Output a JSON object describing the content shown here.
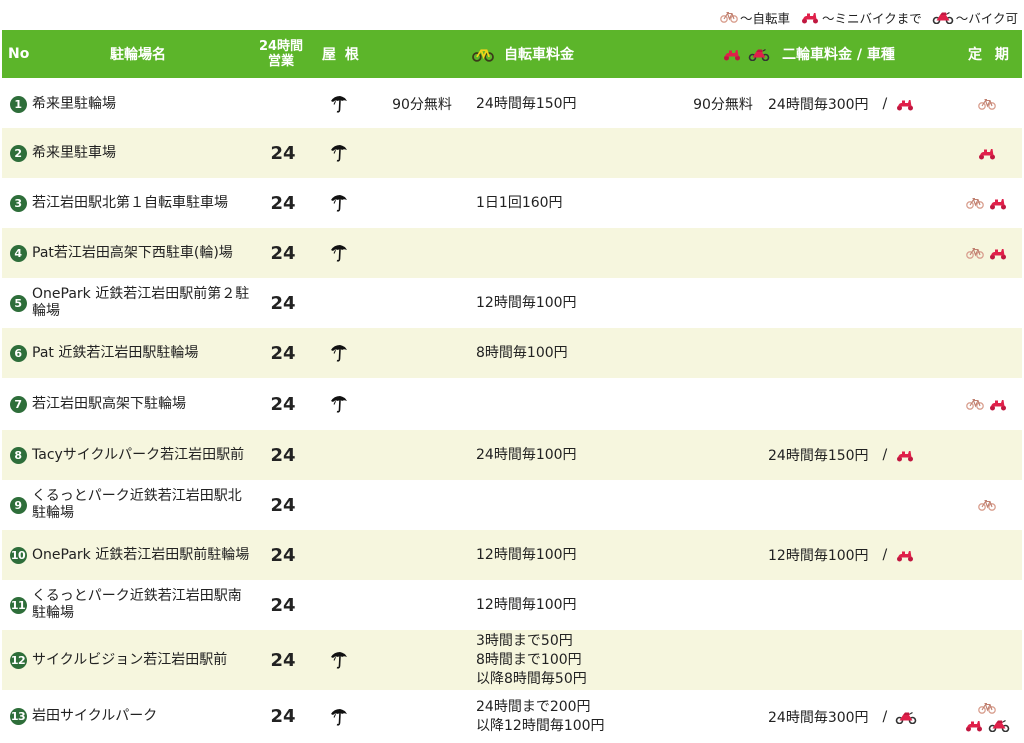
{
  "legend": {
    "bicycle_label": "～自転車",
    "minibike_label": "～ミニバイクまで",
    "motorbike_label": "～バイク可"
  },
  "header": {
    "no": "No",
    "name": "駐輪場名",
    "h24_line1": "24時間",
    "h24_line2": "営業",
    "roof": "屋 根",
    "bike_fee": "自転車料金",
    "moto_fee": "二輪車料金 / 車種",
    "teiki": "定 期"
  },
  "colors": {
    "header_green": "#5cb52a",
    "row_alt": "#f6f6de",
    "number_badge": "#2e6e3a",
    "bicycle_icon": "#d9a090",
    "minibike_icon": "#e0204a"
  },
  "rows": [
    {
      "no": "1",
      "name": "希来里駐輪場",
      "h24": "",
      "roof": true,
      "bike_free": "90分無料",
      "bike_fee": "24時間毎150円",
      "moto_free": "90分無料",
      "moto_fee": "24時間毎300円",
      "moto_sep": "/",
      "moto_icon": "minibike-icon",
      "teiki": [
        "bicycle-icon"
      ]
    },
    {
      "no": "2",
      "name": "希来里駐車場",
      "h24": "24",
      "roof": true,
      "bike_free": "",
      "bike_fee": "",
      "moto_free": "",
      "moto_fee": "",
      "moto_sep": "",
      "moto_icon": "",
      "teiki": [
        "minibike-icon"
      ]
    },
    {
      "no": "3",
      "name": "若江岩田駅北第１自転車駐車場",
      "h24": "24",
      "roof": true,
      "bike_free": "",
      "bike_fee": "1日1回160円",
      "moto_free": "",
      "moto_fee": "",
      "moto_sep": "",
      "moto_icon": "",
      "teiki": [
        "bicycle-icon",
        "minibike-icon"
      ]
    },
    {
      "no": "4",
      "name": "Pat若江岩田高架下西駐車(輪)場",
      "h24": "24",
      "roof": true,
      "bike_free": "",
      "bike_fee": "",
      "moto_free": "",
      "moto_fee": "",
      "moto_sep": "",
      "moto_icon": "",
      "teiki": [
        "bicycle-icon",
        "minibike-icon"
      ]
    },
    {
      "no": "5",
      "name": "OnePark 近鉄若江岩田駅前第２駐輪場",
      "h24": "24",
      "roof": false,
      "bike_free": "",
      "bike_fee": "12時間毎100円",
      "moto_free": "",
      "moto_fee": "",
      "moto_sep": "",
      "moto_icon": "",
      "teiki": []
    },
    {
      "no": "6",
      "name": "Pat 近鉄若江岩田駅駐輪場",
      "h24": "24",
      "roof": true,
      "bike_free": "",
      "bike_fee": "8時間毎100円",
      "moto_free": "",
      "moto_fee": "",
      "moto_sep": "",
      "moto_icon": "",
      "teiki": []
    },
    {
      "no": "7",
      "name": "若江岩田駅高架下駐輪場",
      "h24": "24",
      "roof": true,
      "bike_free": "",
      "bike_fee": "",
      "moto_free": "",
      "moto_fee": "",
      "moto_sep": "",
      "moto_icon": "",
      "teiki": [
        "bicycle-icon",
        "minibike-icon"
      ]
    },
    {
      "no": "8",
      "name": "Tacyサイクルパーク若江岩田駅前",
      "h24": "24",
      "roof": false,
      "bike_free": "",
      "bike_fee": "24時間毎100円",
      "moto_free": "",
      "moto_fee": "24時間毎150円",
      "moto_sep": "/",
      "moto_icon": "minibike-icon",
      "teiki": []
    },
    {
      "no": "9",
      "name": "くるっとパーク近鉄若江岩田駅北駐輪場",
      "h24": "24",
      "roof": false,
      "bike_free": "",
      "bike_fee": "",
      "moto_free": "",
      "moto_fee": "",
      "moto_sep": "",
      "moto_icon": "",
      "teiki": [
        "bicycle-icon"
      ]
    },
    {
      "no": "10",
      "name": "OnePark 近鉄若江岩田駅前駐輪場",
      "h24": "24",
      "roof": false,
      "bike_free": "",
      "bike_fee": "12時間毎100円",
      "moto_free": "",
      "moto_fee": "12時間毎100円",
      "moto_sep": "/",
      "moto_icon": "minibike-icon",
      "teiki": []
    },
    {
      "no": "11",
      "name": "くるっとパーク近鉄若江岩田駅南駐輪場",
      "h24": "24",
      "roof": false,
      "bike_free": "",
      "bike_fee": "12時間毎100円",
      "moto_free": "",
      "moto_fee": "",
      "moto_sep": "",
      "moto_icon": "",
      "teiki": []
    },
    {
      "no": "12",
      "name": "サイクルビジョン若江岩田駅前",
      "h24": "24",
      "roof": true,
      "bike_free": "",
      "bike_fee": "3時間まで50円\n8時間まで100円\n以降8時間毎50円",
      "moto_free": "",
      "moto_fee": "",
      "moto_sep": "",
      "moto_icon": "",
      "teiki": []
    },
    {
      "no": "13",
      "name": "岩田サイクルパーク",
      "h24": "24",
      "roof": true,
      "bike_free": "",
      "bike_fee": "24時間まで200円\n以降12時間毎100円",
      "moto_free": "",
      "moto_fee": "24時間毎300円",
      "moto_sep": "/",
      "moto_icon": "motorbike-icon",
      "teiki": [
        "bicycle-icon",
        "minibike-icon",
        "motorbike-icon"
      ]
    }
  ]
}
